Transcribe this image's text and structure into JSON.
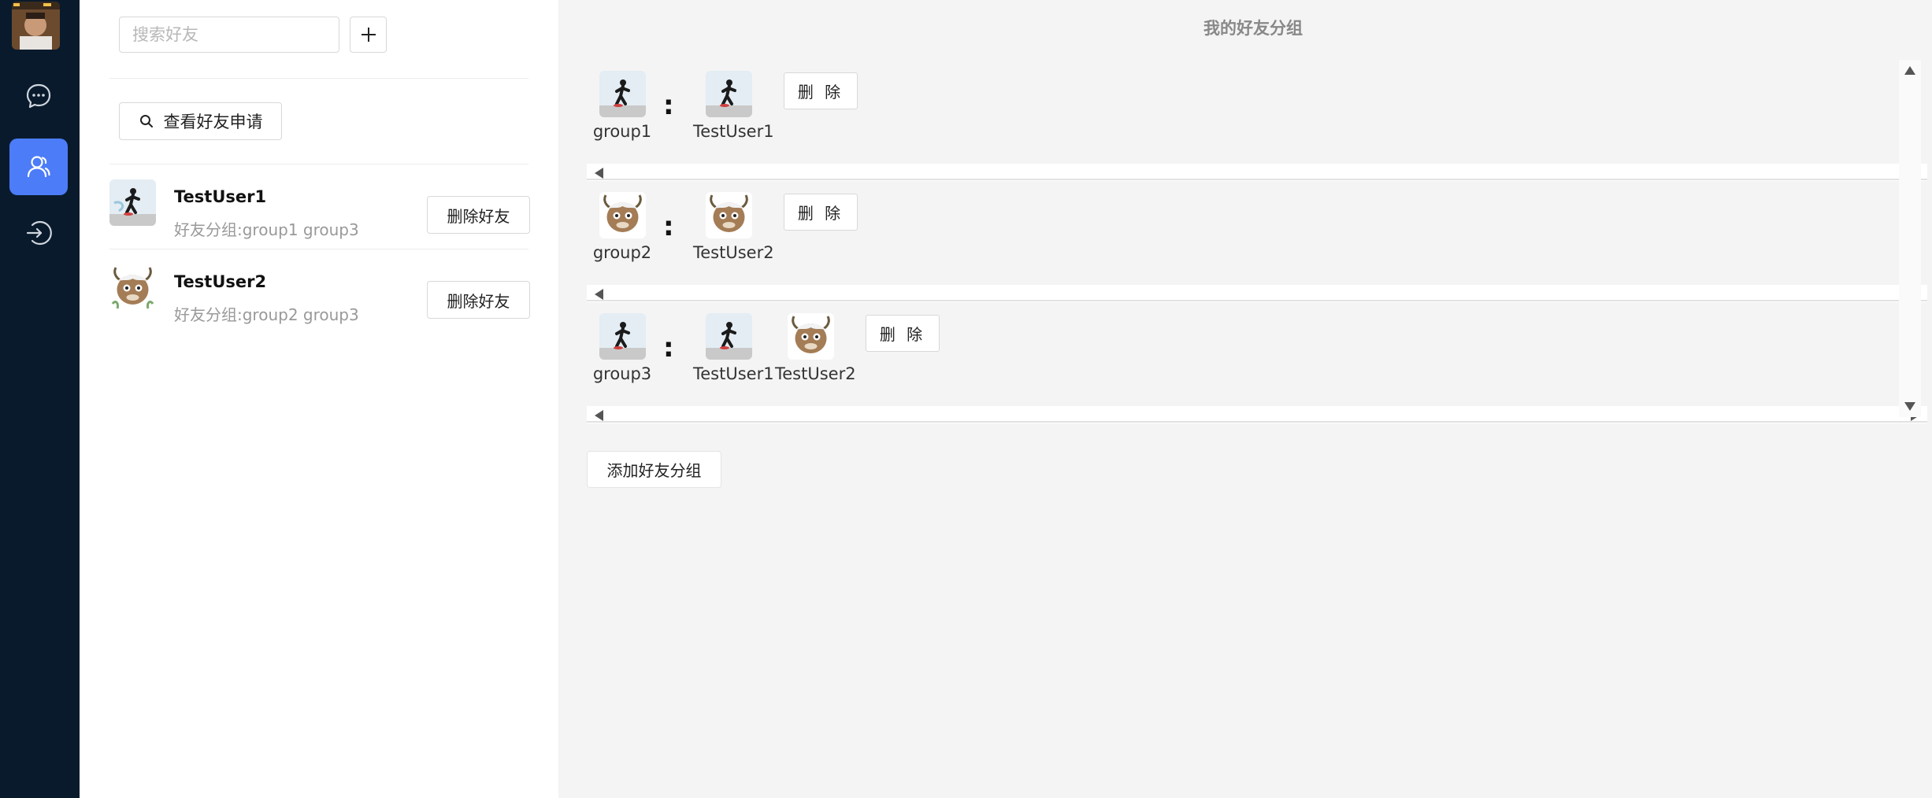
{
  "sidebar": {
    "icons": [
      "user-avatar",
      "chat-bubble-icon",
      "contacts-icon",
      "logout-icon"
    ],
    "active_item": "contacts",
    "accent_color": "#4c7cf7",
    "background_color": "#091a2c"
  },
  "friend_list": {
    "search_placeholder": "搜索好友",
    "add_icon": "plus-icon",
    "view_requests_label": "查看好友申请",
    "search_icon": "search-icon",
    "friends": [
      {
        "name": "TestUser1",
        "groups_text": "好友分组:group1 group3",
        "delete_label": "删除好友",
        "avatar": "skater-avatar"
      },
      {
        "name": "TestUser2",
        "groups_text": "好友分组:group2 group3",
        "delete_label": "删除好友",
        "avatar": "goat-avatar"
      }
    ]
  },
  "groups_panel": {
    "title": "我的好友分组",
    "colon": ":",
    "groups": [
      {
        "name": "group1",
        "members": [
          "TestUser1"
        ],
        "delete_label": "删 除"
      },
      {
        "name": "group2",
        "members": [
          "TestUser2"
        ],
        "delete_label": "删 除"
      },
      {
        "name": "group3",
        "members": [
          "TestUser1",
          "TestUser2"
        ],
        "delete_label": "删 除"
      }
    ],
    "add_group_label": "添加好友分组"
  }
}
